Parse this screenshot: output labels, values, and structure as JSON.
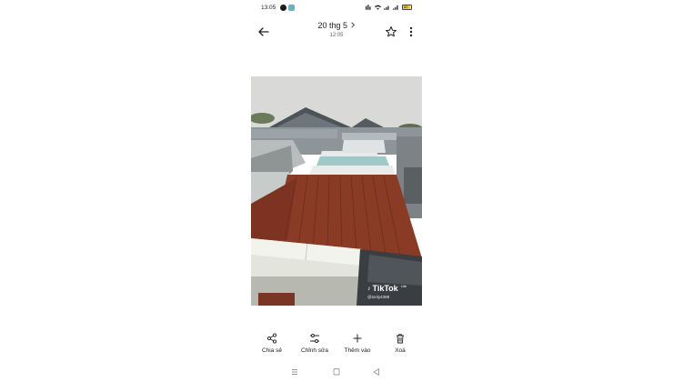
{
  "status_bar": {
    "time": "13:05",
    "notification_icons": [
      "facebook-icon",
      "app-notification-icon"
    ],
    "battery_label": "89",
    "battery_level": 0.89,
    "battery_color": "#f2c94c"
  },
  "header": {
    "title": "20 thg 5",
    "subtitle": "12:05"
  },
  "photo": {
    "watermark_brand": "TikTok",
    "watermark_edition": "Lite",
    "watermark_user": "@tonly4388"
  },
  "actions": [
    {
      "label": "Chia sẻ",
      "icon": "share-icon"
    },
    {
      "label": "Chỉnh sửa",
      "icon": "edit-icon"
    },
    {
      "label": "Thêm vào",
      "icon": "add-icon"
    },
    {
      "label": "Xoá",
      "icon": "delete-icon"
    }
  ],
  "nav": [
    "recent-apps-icon",
    "home-icon",
    "back-nav-icon"
  ],
  "colors": {
    "background": "#ffffff",
    "text": "#202124",
    "roof_rust": "#8a3b26",
    "sky": "#d8d8d6"
  }
}
